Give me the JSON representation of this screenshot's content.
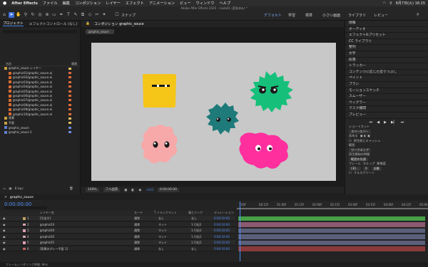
{
  "menubar": {
    "apple": "",
    "app": "After Effects",
    "items": [
      "ファイル",
      "編集",
      "コンポジション",
      "レイヤー",
      "エフェクト",
      "アニメーション",
      "ビュー",
      "ウィンドウ",
      "ヘルプ"
    ],
    "clock": "6月7日(火)  16:15"
  },
  "title": "Adobe After Effects 2020 - /sada01 (変換済み) *",
  "toolbar": {
    "snap": "スナップ",
    "workspaces": [
      "デフォルト",
      "学習",
      "標準",
      "小さい画面",
      "ライブラリ",
      "レビュー"
    ]
  },
  "project": {
    "tabs": [
      "プロジェクト",
      "エフェクトコントロール (なし)"
    ],
    "header": {
      "name": "名前",
      "type": "種類"
    },
    "items": [
      {
        "label": "graphic_souce レイヤー",
        "icon": "folder",
        "tag": "#e0c060"
      },
      {
        "label": "graphic01/graphic_souce.ai",
        "icon": "ai",
        "tag": "#e06a3a"
      },
      {
        "label": "graphic02/graphic_souce.ai",
        "icon": "ai",
        "tag": "#e06a3a"
      },
      {
        "label": "graphic03/graphic_souce.ai",
        "icon": "ai",
        "tag": "#e06a3a"
      },
      {
        "label": "graphic04/graphic_souce.ai",
        "icon": "ai",
        "tag": "#e06a3a"
      },
      {
        "label": "graphic05/graphic_souce.ai",
        "icon": "ai",
        "tag": "#e06a3a"
      },
      {
        "label": "graphic06/graphic_souce.ai",
        "icon": "ai",
        "tag": "#e06a3a"
      },
      {
        "label": "graphic07/graphic_souce.ai",
        "icon": "ai",
        "tag": "#e06a3a"
      },
      {
        "label": "graphic08/graphic_souce.ai",
        "icon": "ai",
        "tag": "#e06a3a"
      },
      {
        "label": "graphic09/graphic_souce.ai",
        "icon": "ai",
        "tag": "#e06a3a"
      },
      {
        "label": "graphic10/graphic_souce.ai",
        "icon": "ai",
        "tag": "#e06a3a"
      },
      {
        "label": "背景",
        "icon": "folder",
        "tag": "#e0c060"
      },
      {
        "label": "平面",
        "icon": "folder",
        "tag": "#e0c060"
      },
      {
        "label": "graphic_souce",
        "icon": "comp",
        "tag": "#6a8ad8"
      },
      {
        "label": "graphic_souce 2",
        "icon": "comp",
        "tag": "#6a8ad8"
      }
    ],
    "bitdepth": "8 bpc"
  },
  "composition": {
    "tab": "コンポジション graphic_souce",
    "crumb": "graphic_souce",
    "zoom": "100%",
    "quality": "フル画質",
    "exposure": "+0.0",
    "time": "0:00:00:00"
  },
  "right": {
    "panels": [
      "情報",
      "オーディオ",
      "エフェクト&プリセット",
      "CC ライブラリ",
      "整列",
      "文字",
      "段落",
      "トラッカー",
      "コンテンツに応じた塗りつぶし",
      "ペイント",
      "ブラシ",
      "モーションスケッチ",
      "スムーザー",
      "ウィグラー",
      "マスク補間",
      "プレビュー"
    ],
    "preview": {
      "shortcut_label": "ショートカット",
      "shortcut_value": "スペースバー",
      "include_label": "含める",
      "cache_label": "再生前にキャッシュ",
      "range_label": "範囲",
      "range_value": "ワークエリア",
      "start_label": "再生開始の時間",
      "start_value": "範囲の先頭",
      "frame_label": "フレーム",
      "skip_label": "スキップ",
      "res_label": "解像度",
      "frame_value": "(30...",
      "skip_value": "0",
      "res_value": "自動",
      "fullscreen_label": "フルスクリーン"
    }
  },
  "timeline": {
    "tab": "graphic_souce",
    "timecode": "0:00:00:00",
    "headers": {
      "name": "レイヤー名",
      "mode": "モード",
      "track": "T トラックマット",
      "parent": "親とリンク",
      "duration": "デュレーション"
    },
    "layers": [
      {
        "num": "1",
        "name": "[引出す]",
        "color": "#c0a060",
        "mode": "通常",
        "track": "なし",
        "parent": "なし",
        "dur": "0:00:10:00"
      },
      {
        "num": "2",
        "name": "graphic03",
        "color": "#d8a0b8",
        "mode": "通常",
        "track": "マット",
        "parent": "1.引出1",
        "dur": "0:00:10:00"
      },
      {
        "num": "3",
        "name": "graphic04",
        "color": "#d8a0b8",
        "mode": "通常",
        "track": "マット",
        "parent": "1.引出1",
        "dur": "0:00:10:00"
      },
      {
        "num": "4",
        "name": "graphic02",
        "color": "#d8a0b8",
        "mode": "通常",
        "track": "マット",
        "parent": "1.引出1",
        "dur": "0:00:10:00"
      },
      {
        "num": "5",
        "name": "graphic01",
        "color": "#d8a0b8",
        "mode": "通常",
        "track": "マット",
        "parent": "1.引出1",
        "dur": "0:00:10:00"
      },
      {
        "num": "6",
        "name": "[背景のグレー平面 1]",
        "color": "#c06060",
        "mode": "通常",
        "track": "なし",
        "parent": "なし",
        "dur": "0:00:10:00"
      }
    ],
    "ruler": [
      "00f",
      "00:15f",
      "01:00f",
      "01:15f",
      "02:00f",
      "02:15f",
      "03:00f",
      "03:15f",
      "04:00f",
      "04:15f",
      "05:00"
    ],
    "bar_colors": [
      "#47a047",
      "#8a5a70",
      "#5a5f7a",
      "#5a5f7a",
      "#5a5f7a",
      "#8a3a3a"
    ],
    "footer": "フレームレンダリング時間: 8ms"
  },
  "colors": {
    "accent": "#4f8ef7",
    "yellow": "#f5c518",
    "teal": "#1f7a7a",
    "green": "#16c07a",
    "pink": "#f7a8a8",
    "magenta": "#ff2f9e"
  }
}
